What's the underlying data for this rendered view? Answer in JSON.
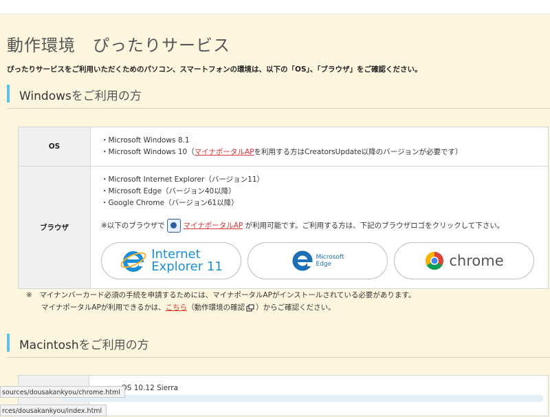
{
  "page": {
    "title": "動作環境　ぴったりサービス",
    "intro": "ぴったりサービスをご利用いただくためのパソコン、スマートフォンの環境は、以下の「OS」、「ブラウザ」をご確認ください。"
  },
  "windows": {
    "heading_latin": "Windows",
    "heading_jp": "をご利用の方",
    "os_label": "OS",
    "os_line1": "・Microsoft Windows 8.1",
    "os_line2_pre": "・Microsoft Windows 10（",
    "os_line2_link": "マイナポータルAP",
    "os_line2_post": "を利用する方はCreatorsUpdate以降のバージョンが必要です）",
    "browser_label": "ブラウザ",
    "browser_line1": "・Microsoft Internet Explorer（バージョン11）",
    "browser_line2": "・Microsoft Edge（バージョン40以降）",
    "browser_line3": "・Google Chrome（バージョン61以降）",
    "note_pre": "※以下のブラウザで",
    "note_link": "マイナポータルAP",
    "note_post": "が利用可能です。ご利用する方は、下記のブラウザロゴをクリックして下さい。",
    "buttons": {
      "ie_line1": "Internet",
      "ie_line2": "Explorer 11",
      "edge_line1": "Microsoft",
      "edge_line2": "Edge",
      "chrome": "chrome"
    }
  },
  "footnote": {
    "mark": "※",
    "line1": "マイナンバーカード必須の手続を申請するためには、マイナポータルAPがインストールされている必要があります。",
    "line2_pre": "マイナポータルAPが利用できるかは、",
    "line2_link": "こちら",
    "line2_mid": "（動作環境の確認",
    "line2_post": "）からご確認ください。"
  },
  "mac": {
    "heading_latin": "Macintosh",
    "heading_jp": "をご利用の方",
    "os_line1": "macOS 10.12 Sierra"
  },
  "statusbar": {
    "url1": "sources/dousakankyou/chrome.html",
    "url2": "rces/dousakankyou/index.html"
  },
  "colors": {
    "accent_bar": "#5cc0e8",
    "link_red": "#dd3333",
    "ie_blue": "#1b8fd6",
    "edge_blue": "#1b6fb6",
    "page_bg": "#fdf6df"
  }
}
